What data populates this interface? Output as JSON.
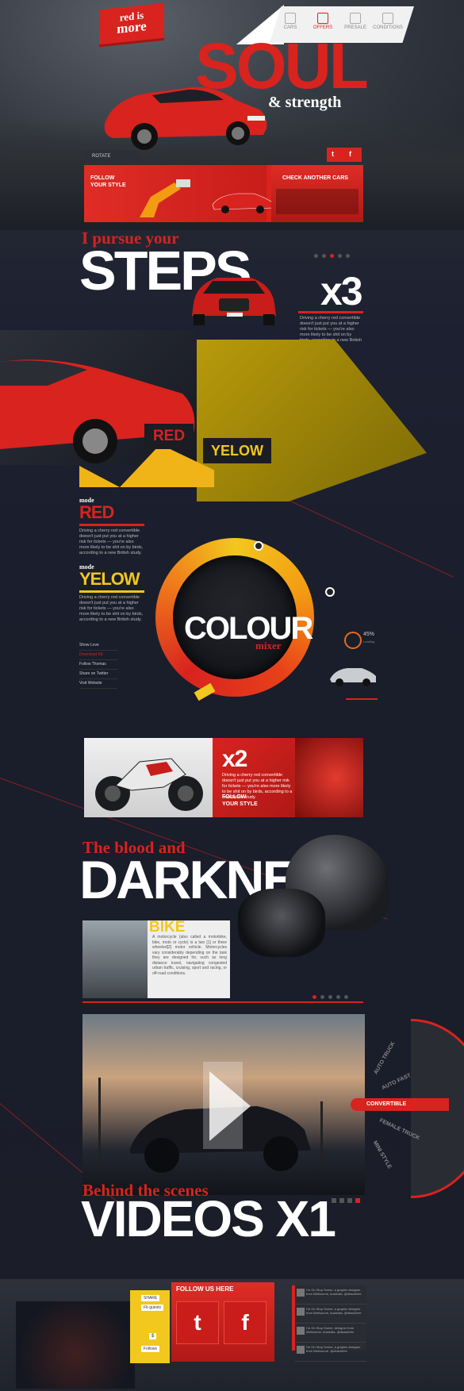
{
  "header": {
    "logo_line1": "red is",
    "logo_line2": "more",
    "nav": [
      {
        "label": "CARS",
        "icon": "car-icon"
      },
      {
        "label": "OFFERS",
        "icon": "tag-icon"
      },
      {
        "label": "PRESALE",
        "icon": "document-icon"
      },
      {
        "label": "CONDITIONS",
        "icon": "list-icon"
      }
    ]
  },
  "hero": {
    "title": "SOUL",
    "subtitle": "& strength",
    "rotate_label": "ROTATE",
    "follow_label_1": "FOLLOW",
    "follow_label_2": "YOUR STYLE",
    "check_label": "CHECK ANOTHER CARS",
    "social": [
      "twitter-icon",
      "facebook-icon"
    ]
  },
  "steps": {
    "kicker": "I pursue your",
    "title": "STEPS",
    "counter": "x3",
    "text": "Driving a cherry red convertible doesn't just put you at a higher risk for tickets — you're also more likely to be shit on by birds, according to a new British study."
  },
  "collage": {
    "red_tag": "RED",
    "yellow_tag": "YELOW"
  },
  "modes": [
    {
      "kicker": "mode",
      "name": "RED",
      "color": "#d8231f",
      "text": "Driving a cherry red convertible doesn't just put you at a higher risk for tickets — you're also more likely to be shit on by birds, according to a new British study."
    },
    {
      "kicker": "mode",
      "name": "YELOW",
      "color": "#f2c71e",
      "text": "Driving a cherry red convertible doesn't just put you at a higher risk for tickets — you're also more likely to be shit on by birds, according to a new British study."
    }
  ],
  "links": [
    "Show Love",
    "Download Kit",
    "Follow Thomas",
    "Share on Twitter",
    "Visit Website"
  ],
  "mixer": {
    "title": "COLOUR",
    "subtitle": "mixer",
    "percent": "45%",
    "percent_caption": "Loading"
  },
  "bike_promo": {
    "counter": "x2",
    "text": "Driving a cherry red convertible doesn't just put you at a higher risk for tickets — you're also more likely to be shit on by birds, according to a new British study.",
    "follow_1": "FOLLOW",
    "follow_2": "YOUR STYLE"
  },
  "darkness": {
    "kicker": "The blood and",
    "title": "DARKNES",
    "card_title": "BIKE",
    "card_text": "A motorcycle (also called a motorbike, bike, moto or cycle) is a two [1] or three wheeled[2] motor vehicle. Motorcycles vary considerably depending on the task they are designed for, such as long distance travel, navigating congested urban traffic, cruising, sport and racing, or off-road conditions."
  },
  "video": {
    "wheel_items": [
      "AUTO TRUCK",
      "AUTO FAST",
      "CONVERTIBLE",
      "FEMALE TRUCK",
      "MINI STYLE"
    ],
    "active_item": "CONVERTIBLE",
    "kicker": "Behind the scenes",
    "title": "VIDEOS X1"
  },
  "footer": {
    "follow_title": "FOLLOW US HERE",
    "buttons": [
      "t",
      "f"
    ],
    "mini_labels": [
      "SHARE",
      "Fb guests",
      "$",
      "Follows"
    ],
    "feed": [
      "I'm On Stop Scene, a graphic designer from Melbourne, Australia. @dbackfree",
      "I'm On Stop Scene, a graphic designer from Melbourne, Australia. @dbackfree",
      "I'm On Stop Scene, designer from Melbourne, Australia. @dbackfree",
      "I'm On Stop Scene, a graphic designer from Melbourne. @dbackfree"
    ]
  },
  "colors": {
    "accent": "#d8231f",
    "yellow": "#f2c71e",
    "bg": "#1b1e29"
  }
}
